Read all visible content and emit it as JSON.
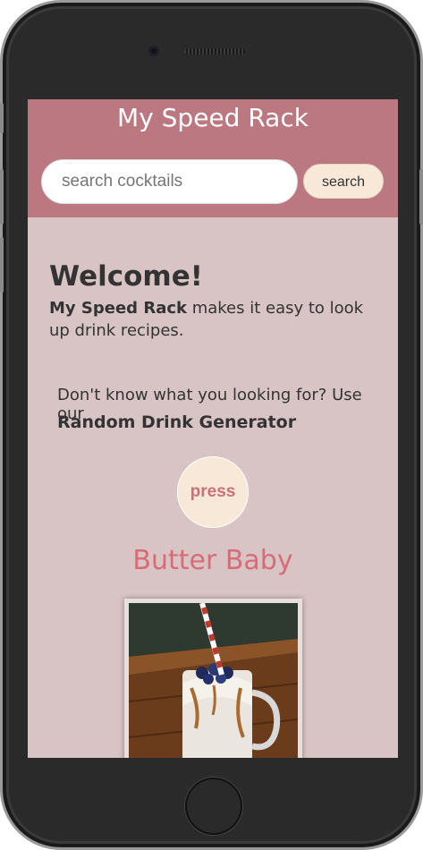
{
  "app": {
    "title": "My Speed Rack"
  },
  "search": {
    "placeholder": "search cocktails",
    "button_label": "search"
  },
  "welcome": {
    "heading": "Welcome!",
    "brand": "My Speed Rack",
    "text": " makes it easy to look up drink recipes."
  },
  "random": {
    "prompt": "Don't know what you looking for? Use our",
    "title": "Random Drink Generator",
    "button_label": "press"
  },
  "drink": {
    "name": "Butter Baby"
  },
  "colors": {
    "header": "#bc7880",
    "background": "#d9c4c5",
    "accent": "#d96b76",
    "button": "#f7e8d8"
  }
}
